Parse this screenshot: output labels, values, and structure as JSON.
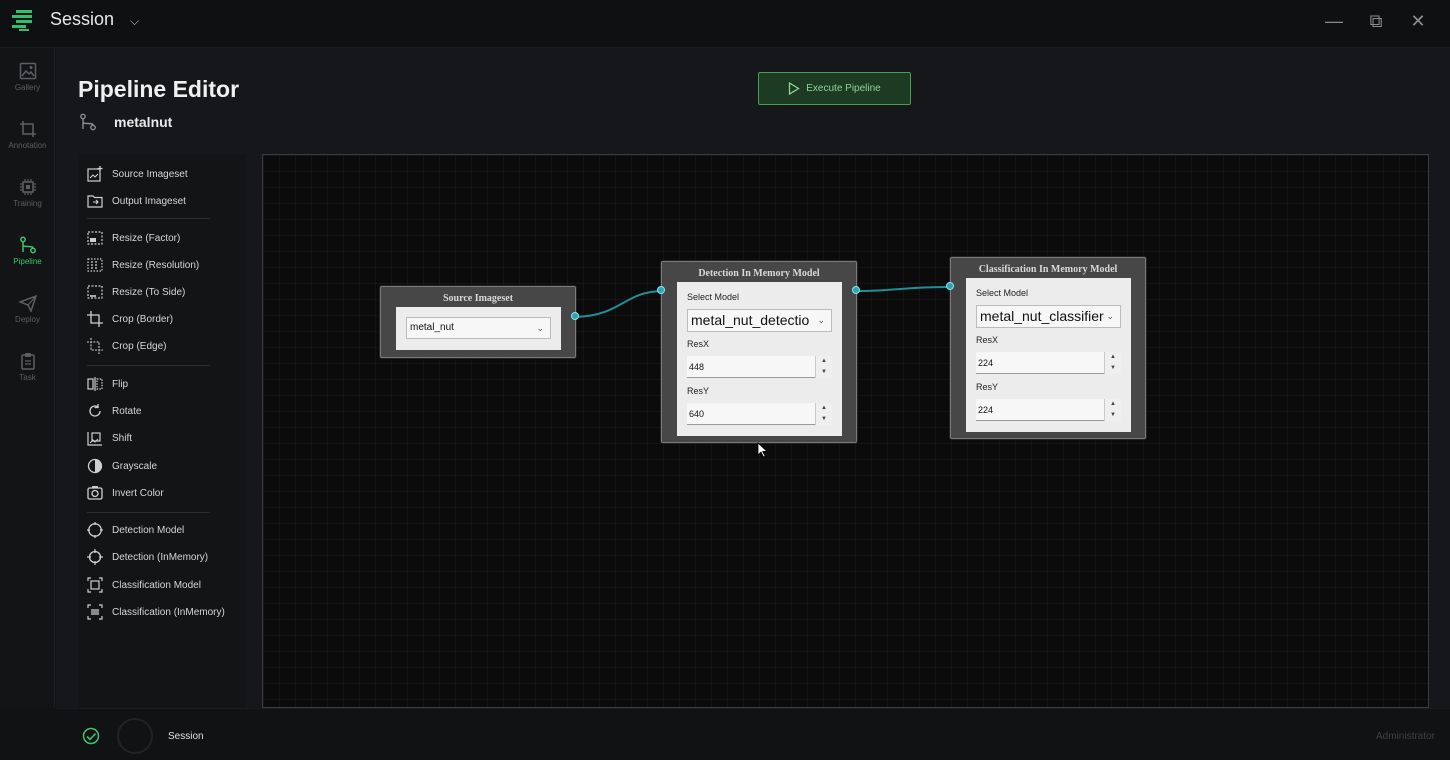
{
  "titlebar": {
    "title": "Session",
    "chevron": "⌄"
  },
  "window_controls": {
    "minimize": "—",
    "maximize": "⧉",
    "close": "✕"
  },
  "rail": [
    {
      "label": "Gallery",
      "icon": "image-icon"
    },
    {
      "label": "Annotation",
      "icon": "crop-icon"
    },
    {
      "label": "Training",
      "icon": "chip-icon"
    },
    {
      "label": "Pipeline",
      "icon": "pipeline-icon",
      "active": true
    },
    {
      "label": "Deploy",
      "icon": "send-icon"
    },
    {
      "label": "Task",
      "icon": "clipboard-icon"
    }
  ],
  "header": {
    "title": "Pipeline Editor",
    "pipeline_name": "metalnut",
    "execute_label": "Execute Pipeline"
  },
  "palette": [
    {
      "label": "Source Imageset",
      "icon": "image-add-icon"
    },
    {
      "label": "Output Imageset",
      "icon": "folder-out-icon"
    },
    {
      "label": "Resize (Factor)",
      "icon": "resize-factor-icon"
    },
    {
      "label": "Resize (Resolution)",
      "icon": "resize-resolution-icon"
    },
    {
      "label": "Resize (To Side)",
      "icon": "resize-side-icon"
    },
    {
      "label": "Crop (Border)",
      "icon": "crop-border-icon"
    },
    {
      "label": "Crop (Edge)",
      "icon": "crop-edge-icon"
    },
    {
      "label": "Flip",
      "icon": "flip-icon"
    },
    {
      "label": "Rotate",
      "icon": "rotate-icon"
    },
    {
      "label": "Shift",
      "icon": "shift-icon"
    },
    {
      "label": "Grayscale",
      "icon": "grayscale-icon"
    },
    {
      "label": "Invert Color",
      "icon": "invert-icon"
    },
    {
      "label": "Detection Model",
      "icon": "detection-model-icon"
    },
    {
      "label": "Detection (InMemory)",
      "icon": "detection-inmemory-icon"
    },
    {
      "label": "Classification Model",
      "icon": "classification-model-icon"
    },
    {
      "label": "Classification (InMemory)",
      "icon": "classification-inmemory-icon"
    }
  ],
  "nodes": {
    "source": {
      "title": "Source Imageset",
      "value": "metal_nut"
    },
    "detection": {
      "title": "Detection In Memory Model",
      "select_label": "Select Model",
      "model": "metal_nut_detectio",
      "resx_label": "ResX",
      "resx": "448",
      "resy_label": "ResY",
      "resy": "640"
    },
    "classification": {
      "title": "Classification In Memory Model",
      "select_label": "Select Model",
      "model": "metal_nut_classifier",
      "resx_label": "ResX",
      "resx": "224",
      "resy_label": "ResY",
      "resy": "224"
    }
  },
  "status": {
    "session": "Session",
    "user": "Administrator"
  },
  "colors": {
    "accent": "#3cc36b",
    "port": "#2aa6b3",
    "edge": "#1f8f99"
  }
}
